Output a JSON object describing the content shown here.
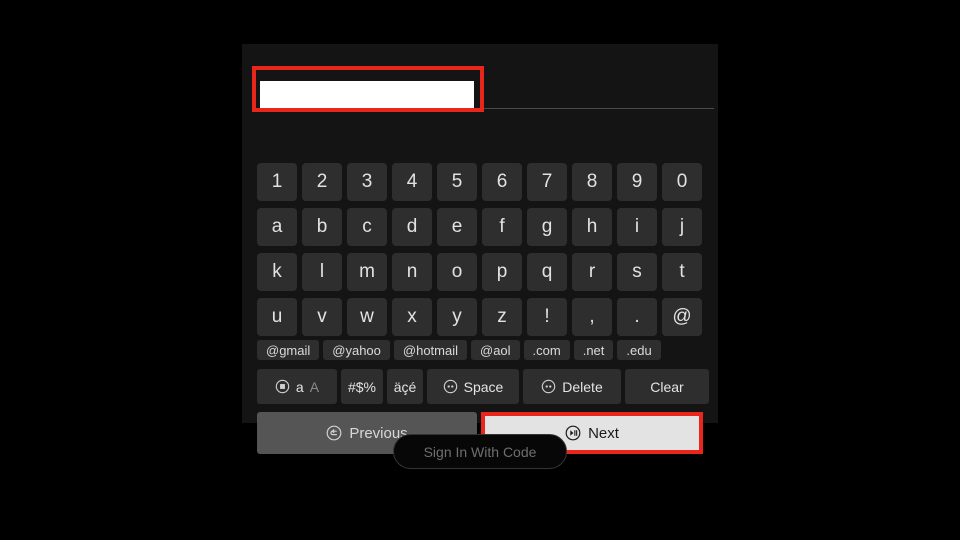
{
  "screen": {
    "background_color": "#000000",
    "panel_background_color": "#141414",
    "highlight_color": "#e8261c",
    "key_color": "#2e2e2e"
  },
  "input": {
    "value": "",
    "placeholder": ""
  },
  "keyboard": {
    "rows": [
      {
        "name": "digits",
        "keys": [
          "1",
          "2",
          "3",
          "4",
          "5",
          "6",
          "7",
          "8",
          "9",
          "0"
        ]
      },
      {
        "name": "alpha1",
        "keys": [
          "a",
          "b",
          "c",
          "d",
          "e",
          "f",
          "g",
          "h",
          "i",
          "j"
        ]
      },
      {
        "name": "alpha2",
        "keys": [
          "k",
          "l",
          "m",
          "n",
          "o",
          "p",
          "q",
          "r",
          "s",
          "t"
        ]
      },
      {
        "name": "alpha3",
        "keys": [
          "u",
          "v",
          "w",
          "x",
          "y",
          "z",
          "!",
          ",",
          ".",
          "@"
        ]
      }
    ],
    "domains": [
      "@gmail",
      "@yahoo",
      "@hotmail",
      "@aol",
      ".com",
      ".net",
      ".edu"
    ],
    "functions": {
      "case_icon": "circle-square-icon",
      "case_label_active": "a",
      "case_label_inactive": "A",
      "symbols_label": "#$%",
      "accents_label": "äçé",
      "space_icon": "circle-two-dots-icon",
      "space_label": "Space",
      "delete_icon": "circle-two-dots-icon",
      "delete_label": "Delete",
      "clear_label": "Clear"
    }
  },
  "navigation": {
    "previous_icon": "circle-back-arrow-icon",
    "previous_label": "Previous",
    "next_icon": "circle-play-pause-icon",
    "next_label": "Next",
    "next_selected": true
  },
  "footer": {
    "sign_in_with_code_label": "Sign In With Code"
  }
}
